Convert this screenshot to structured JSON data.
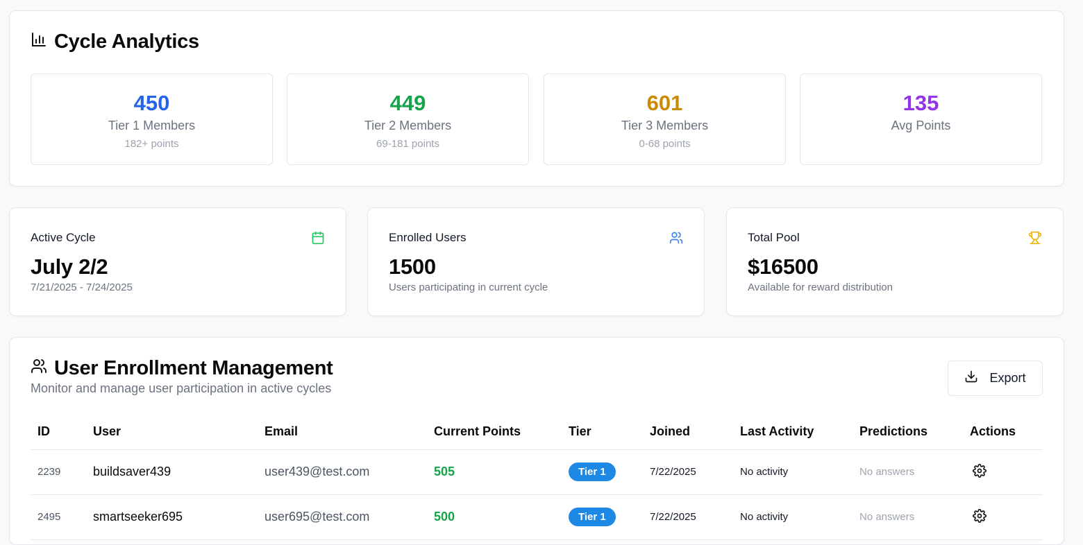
{
  "analytics": {
    "title": "Cycle Analytics",
    "stats": [
      {
        "value": "450",
        "label": "Tier 1 Members",
        "sub": "182+ points",
        "color": "#2563eb"
      },
      {
        "value": "449",
        "label": "Tier 2 Members",
        "sub": "69-181 points",
        "color": "#16a34a"
      },
      {
        "value": "601",
        "label": "Tier 3 Members",
        "sub": "0-68 points",
        "color": "#ca8a04"
      },
      {
        "value": "135",
        "label": "Avg Points",
        "sub": "",
        "color": "#9333ea"
      }
    ]
  },
  "cards": {
    "cycle": {
      "label": "Active Cycle",
      "value": "July 2/2",
      "sub": "7/21/2025 - 7/24/2025",
      "icon": "calendar-icon",
      "icon_color": "#22c55e"
    },
    "enrolled": {
      "label": "Enrolled Users",
      "value": "1500",
      "sub": "Users participating in current cycle",
      "icon": "users-icon",
      "icon_color": "#3b82f6"
    },
    "pool": {
      "label": "Total Pool",
      "value": "$16500",
      "sub": "Available for reward distribution",
      "icon": "trophy-icon",
      "icon_color": "#eab308"
    }
  },
  "enrollment": {
    "title": "User Enrollment Management",
    "subtitle": "Monitor and manage user participation in active cycles",
    "export_label": "Export",
    "columns": [
      "ID",
      "User",
      "Email",
      "Current Points",
      "Tier",
      "Joined",
      "Last Activity",
      "Predictions",
      "Actions"
    ],
    "rows": [
      {
        "id": "2239",
        "user": "buildsaver439",
        "email": "user439@test.com",
        "points": "505",
        "tier": "Tier 1",
        "joined": "7/22/2025",
        "activity": "No activity",
        "predictions": "No answers"
      },
      {
        "id": "2495",
        "user": "smartseeker695",
        "email": "user695@test.com",
        "points": "500",
        "tier": "Tier 1",
        "joined": "7/22/2025",
        "activity": "No activity",
        "predictions": "No answers"
      }
    ]
  }
}
